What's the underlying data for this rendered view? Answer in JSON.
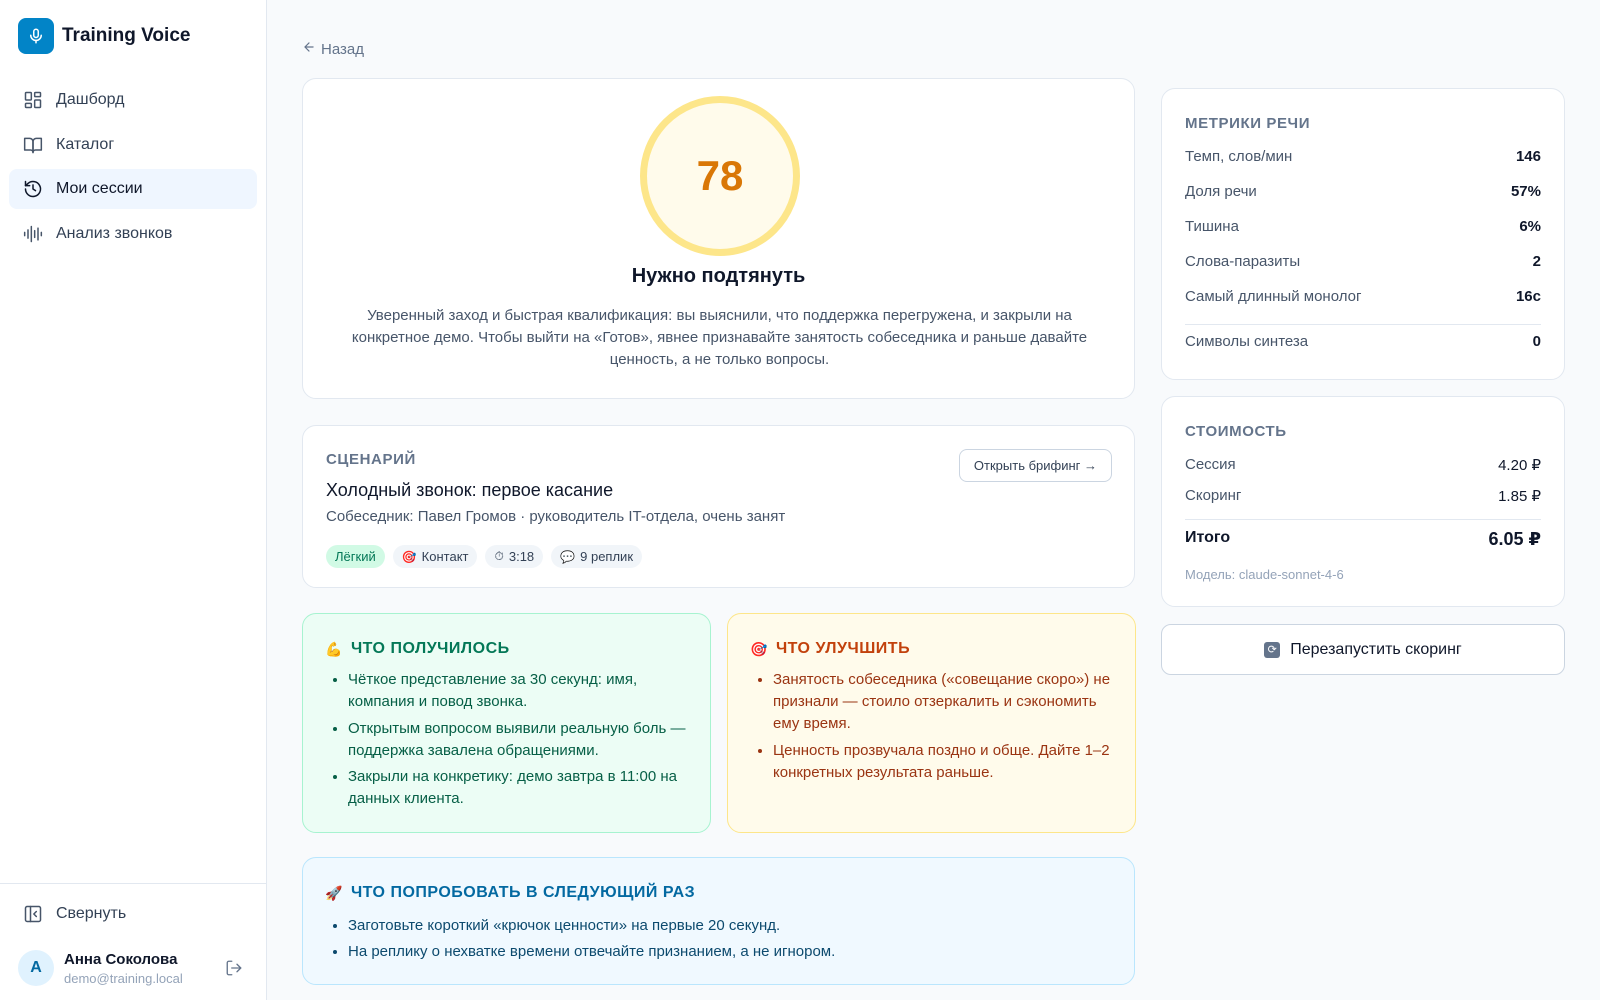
{
  "app": {
    "name": "Training Voice"
  },
  "sidebar": {
    "items": [
      {
        "label": "Дашборд",
        "icon": "dashboard-icon"
      },
      {
        "label": "Каталог",
        "icon": "book-icon"
      },
      {
        "label": "Мои сессии",
        "icon": "history-icon",
        "active": true
      },
      {
        "label": "Анализ звонков",
        "icon": "waveform-icon"
      }
    ],
    "collapse_label": "Свернуть",
    "user": {
      "initial": "А",
      "name": "Анна Соколова",
      "email": "demo@training.local"
    }
  },
  "back_label": "Назад",
  "score": {
    "value": "78",
    "verdict": "Нужно подтянуть",
    "summary": "Уверенный заход и быстрая квалификация: вы выяснили, что поддержка перегружена, и закрыли на конкретное демо. Чтобы выйти на «Готов», явнее признавайте занятость собеседника и раньше давайте ценность, а не только вопросы."
  },
  "scenario": {
    "caption": "Сценарий",
    "title": "Холодный звонок: первое касание",
    "subtitle": "Собеседник: Павел Громов · руководитель IT-отдела, очень занят",
    "brief_button": "Открыть брифинг →",
    "tags": {
      "level": "Лёгкий",
      "stage_icon": "🎯",
      "stage": "Контакт",
      "duration_icon": "⏱",
      "duration": "3:18",
      "turns_icon": "💬",
      "turns": "9 реплик"
    }
  },
  "good": {
    "emoji": "💪",
    "title": "Что получилось",
    "items": [
      "Чёткое представление за 30 секунд: имя, компания и повод звонка.",
      "Открытым вопросом выявили реальную боль — поддержка завалена обращениями.",
      "Закрыли на конкретику: демо завтра в 11:00 на данных клиента."
    ]
  },
  "improve": {
    "emoji": "🎯",
    "title": "Что улучшить",
    "items": [
      "Занятость собеседника («совещание скоро») не признали — стоило отзеркалить и сэкономить ему время.",
      "Ценность прозвучала поздно и обще. Дайте 1–2 конкретных результата раньше."
    ]
  },
  "next": {
    "emoji": "🚀",
    "title": "Что попробовать в следующий раз",
    "items": [
      "Заготовьте короткий «крючок ценности» на первые 20 секунд.",
      "На реплику о нехватке времени отвечайте признанием, а не игнором."
    ]
  },
  "metrics": {
    "caption": "Метрики речи",
    "rows": [
      {
        "label": "Темп, слов/мин",
        "value": "146"
      },
      {
        "label": "Доля речи",
        "value": "57%"
      },
      {
        "label": "Тишина",
        "value": "6%"
      },
      {
        "label": "Слова-паразиты",
        "value": "2"
      },
      {
        "label": "Самый длинный монолог",
        "value": "16с"
      }
    ],
    "synth": {
      "label": "Символы синтеза",
      "value": "0"
    }
  },
  "cost": {
    "caption": "Стоимость",
    "session": {
      "label": "Сессия",
      "value": "4.20 ₽"
    },
    "scoring": {
      "label": "Скоринг",
      "value": "1.85 ₽"
    },
    "total": {
      "label": "Итого",
      "value": "6.05 ₽"
    },
    "model": "Модель: claude-sonnet-4-6"
  },
  "rescore_button": "Перезапустить скоринг",
  "colors": {
    "accent": "#0284c7",
    "score": "#d97706",
    "good": "#047857",
    "improve": "#c2410c",
    "next": "#0369a1"
  }
}
